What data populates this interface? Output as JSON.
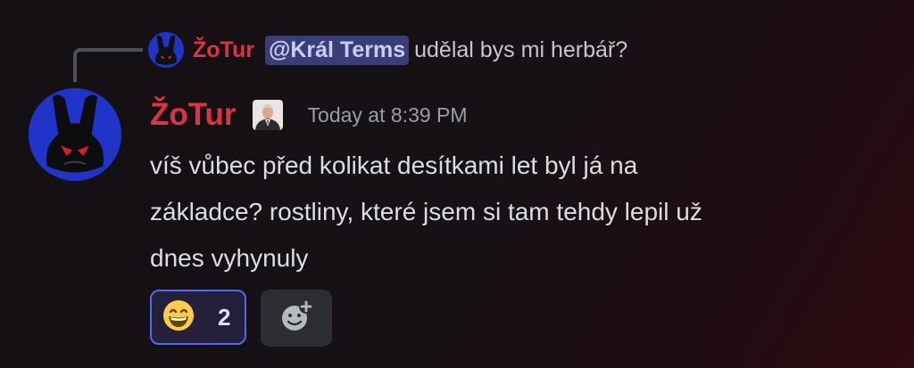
{
  "reply": {
    "author": "ŽoTur",
    "mention": "@Král Terms",
    "text": "udělal bys mi herbář?"
  },
  "message": {
    "author": "ŽoTur",
    "timestamp": "Today at 8:39 PM",
    "lines": [
      "víš vůbec před kolikat desítkami let byl já na",
      "základce? rostliny, které jsem si tam tehdy lepil už",
      "dnes vyhynuly"
    ]
  },
  "reactions": [
    {
      "emoji": "grinning-face-with-smiling-eyes",
      "count": "2",
      "reacted": true
    }
  ],
  "colors": {
    "author": "#dd3345",
    "mention_bg": "#3b3d76",
    "avatar_bg": "#2134c9",
    "reaction_border": "#5865f2"
  },
  "icons": {
    "avatar": "black-rabbit-red-eyes-avatar",
    "role": "portrait-role-icon",
    "add_reaction": "add-reaction-icon"
  }
}
